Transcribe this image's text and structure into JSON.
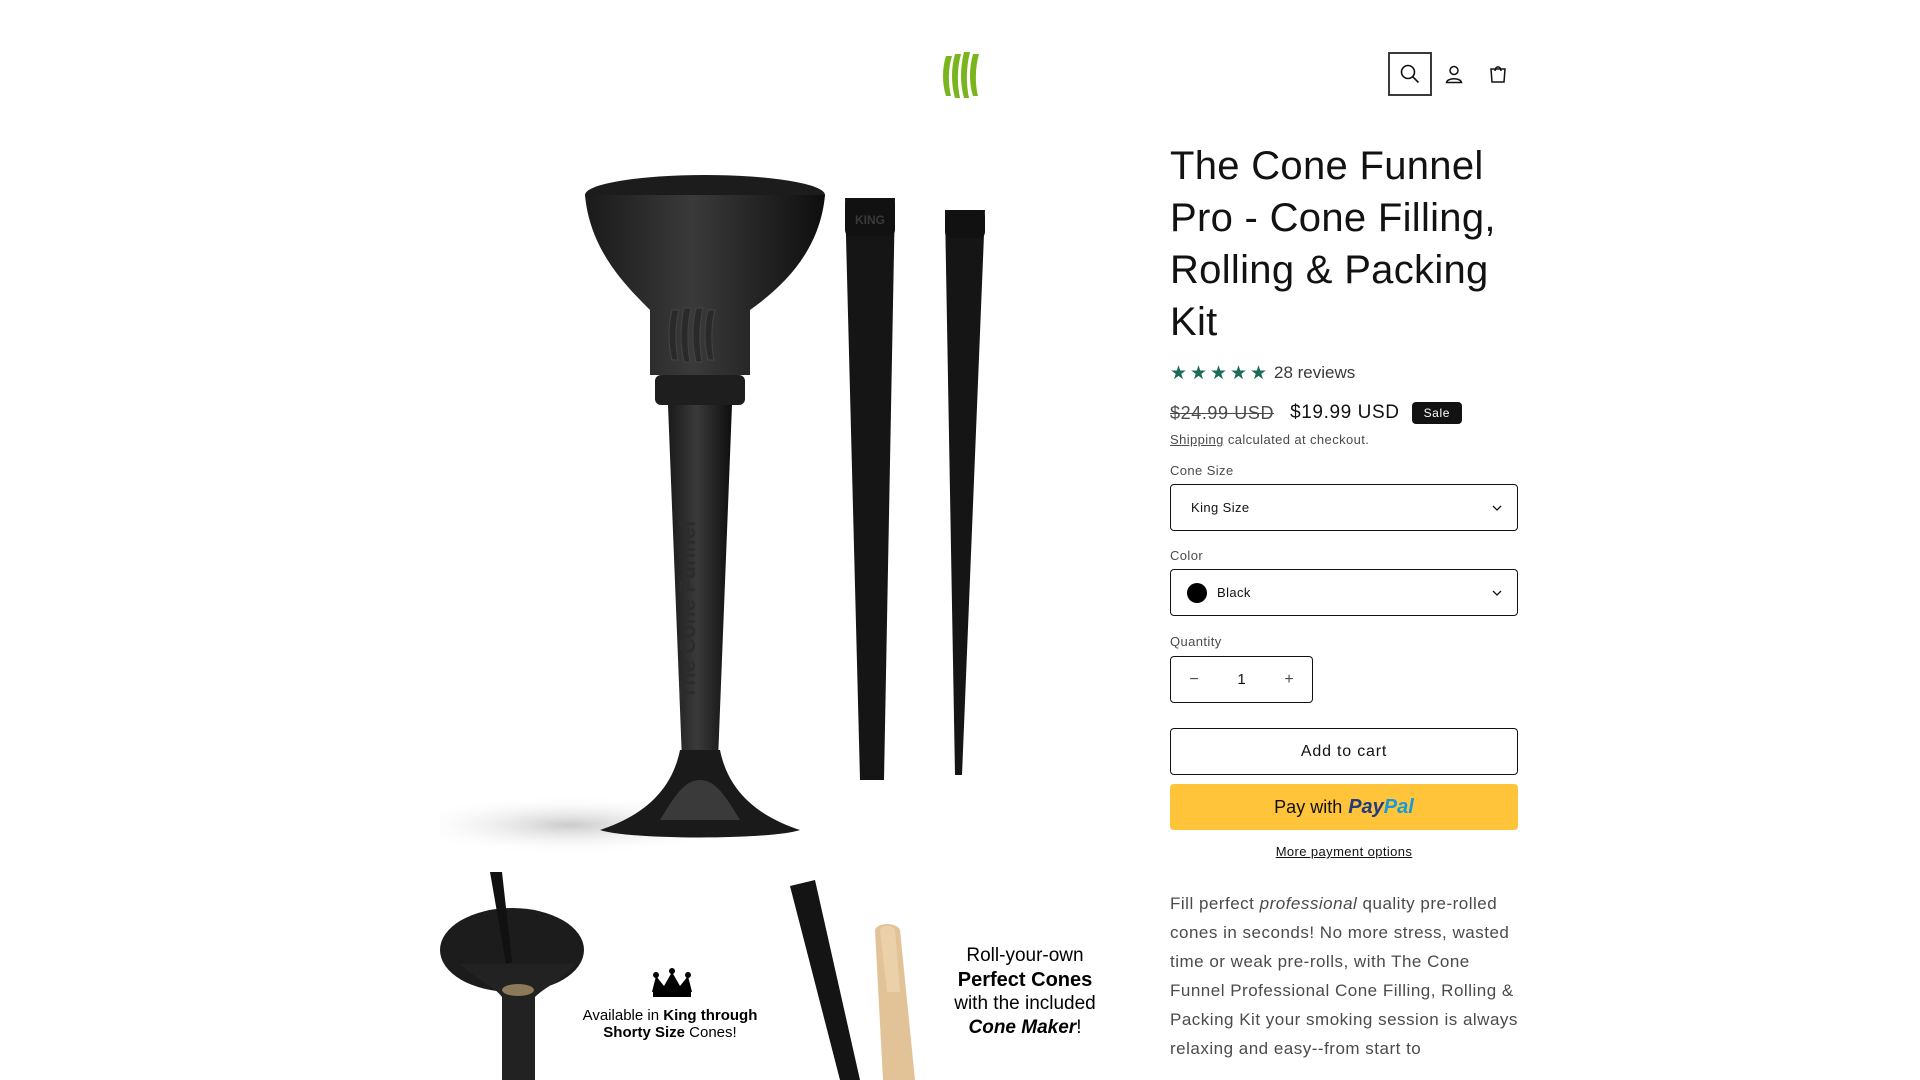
{
  "header": {
    "logo_icon": "green-leaf-stripes-logo",
    "search_icon": "search-icon",
    "account_icon": "account-icon",
    "cart_icon": "cart-icon"
  },
  "media": {
    "main_image_alt": "funnel-and-packing-sticks-image",
    "thumb_left": {
      "line1_pre": "Available in ",
      "line1_bold": "King through",
      "line2_bold": "Shorty Size",
      "line2_post": " Cones!"
    },
    "thumb_right": {
      "line1": "Roll-your-own",
      "line2": "Perfect Cones",
      "line3": "with the included",
      "line4_italic": "Cone Maker",
      "line4_post": "!"
    }
  },
  "product": {
    "title": "The Cone Funnel Pro - Cone Filling, Rolling & Packing Kit",
    "rating_stars": 5,
    "reviews_label": "28 reviews",
    "price_compare": "$24.99 USD",
    "price_sale": "$19.99 USD",
    "sale_badge": "Sale",
    "shipping_link": "Shipping",
    "shipping_text": " calculated at checkout.",
    "cone_size_label": "Cone Size",
    "cone_size_value": "King Size",
    "color_label": "Color",
    "color_value": "Black",
    "quantity_label": "Quantity",
    "quantity_value": "1",
    "add_to_cart": "Add to cart",
    "paypal_prefix": "Pay with",
    "paypal_pay": "Pay",
    "paypal_pal": "Pal",
    "more_payment": "More payment options",
    "desc_pre": "Fill perfect ",
    "desc_em": "professional",
    "desc_post": " quality pre-rolled cones in seconds! No more stress, wasted time or weak pre-rolls, with The Cone Funnel Professional Cone Filling, Rolling & Packing Kit your smoking session is always relaxing and easy--from start to"
  },
  "colors": {
    "star": "#1a6b57",
    "paypal_bg": "#ffc439",
    "logo_green": "#7ab51d"
  }
}
